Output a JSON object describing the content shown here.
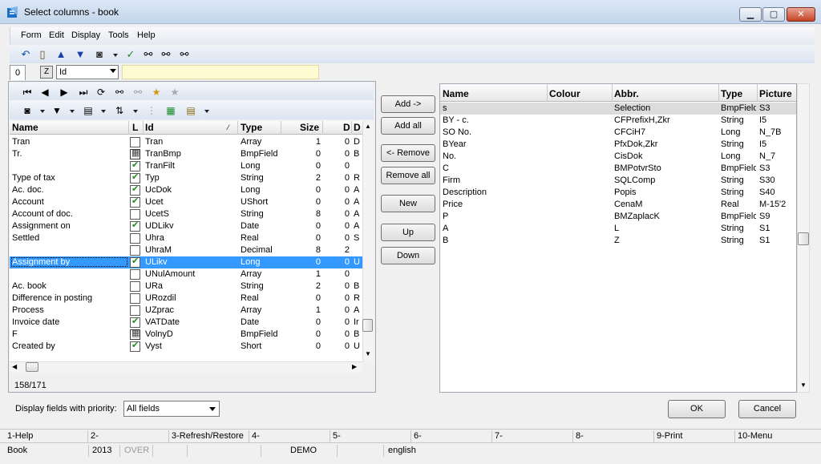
{
  "window": {
    "title": "Select columns - book"
  },
  "menu": [
    "Form",
    "Edit",
    "Display",
    "Tools",
    "Help"
  ],
  "tab": {
    "label": "0"
  },
  "z_button": "Z",
  "id_combo": {
    "value": "Id"
  },
  "left_grid": {
    "headers": [
      "Name",
      "L",
      "Id",
      "Type",
      "Size",
      "D",
      "D"
    ],
    "rows": [
      {
        "name": "Tran",
        "check": "off",
        "id": "Tran",
        "type": "Array",
        "size": "1",
        "d1": "0",
        "d2": "D"
      },
      {
        "name": "Tr.",
        "check": "img",
        "id": "TranBmp",
        "type": "BmpField",
        "size": "0",
        "d1": "0",
        "d2": "B"
      },
      {
        "name": "",
        "check": "on",
        "id": "TranFilt",
        "type": "Long",
        "size": "0",
        "d1": "0",
        "d2": ""
      },
      {
        "name": "Type of tax",
        "check": "on",
        "id": "Typ",
        "type": "String",
        "size": "2",
        "d1": "0",
        "d2": "R"
      },
      {
        "name": "Ac. doc.",
        "check": "on",
        "id": "UcDok",
        "type": "Long",
        "size": "0",
        "d1": "0",
        "d2": "A"
      },
      {
        "name": "Account",
        "check": "on",
        "id": "Ucet",
        "type": "UShort",
        "size": "0",
        "d1": "0",
        "d2": "A"
      },
      {
        "name": "Account of doc.",
        "check": "off",
        "id": "UcetS",
        "type": "String",
        "size": "8",
        "d1": "0",
        "d2": "A"
      },
      {
        "name": "Assignment on",
        "check": "on",
        "id": "UDLikv",
        "type": "Date",
        "size": "0",
        "d1": "0",
        "d2": "A"
      },
      {
        "name": "Settled",
        "check": "off",
        "id": "Uhra",
        "type": "Real",
        "size": "0",
        "d1": "0",
        "d2": "S"
      },
      {
        "name": "",
        "check": "off",
        "id": "UhraM",
        "type": "Decimal",
        "size": "8",
        "d1": "2",
        "d2": ""
      },
      {
        "name": "Assignment by",
        "check": "on",
        "id": "ULikv",
        "type": "Long",
        "size": "0",
        "d1": "0",
        "d2": "U"
      },
      {
        "name": "",
        "check": "off",
        "id": "UNulAmount",
        "type": "Array",
        "size": "1",
        "d1": "0",
        "d2": ""
      },
      {
        "name": "Ac. book",
        "check": "off",
        "id": "URa",
        "type": "String",
        "size": "2",
        "d1": "0",
        "d2": "B"
      },
      {
        "name": "Difference in posting",
        "check": "off",
        "id": "URozdil",
        "type": "Real",
        "size": "0",
        "d1": "0",
        "d2": "R"
      },
      {
        "name": "Process",
        "check": "off",
        "id": "UZprac",
        "type": "Array",
        "size": "1",
        "d1": "0",
        "d2": "A"
      },
      {
        "name": "Invoice date",
        "check": "on",
        "id": "VATDate",
        "type": "Date",
        "size": "0",
        "d1": "0",
        "d2": "Ir"
      },
      {
        "name": "F",
        "check": "img",
        "id": "VolnyD",
        "type": "BmpField",
        "size": "0",
        "d1": "0",
        "d2": "B"
      },
      {
        "name": "Created by",
        "check": "on",
        "id": "Vyst",
        "type": "Short",
        "size": "0",
        "d1": "0",
        "d2": "U"
      }
    ],
    "selected_index": 10
  },
  "count": "158/171",
  "middle_buttons": {
    "add": "Add ->",
    "add_all": "Add all",
    "remove": "<- Remove",
    "remove_all": "Remove all",
    "new": "New",
    "up": "Up",
    "down": "Down"
  },
  "right_grid": {
    "headers": [
      "Name",
      "Colour",
      "Abbr.",
      "Type",
      "Picture"
    ],
    "rows": [
      {
        "name": "s",
        "colour": "",
        "abbr": "Selection",
        "type": "BmpField",
        "picture": "S3"
      },
      {
        "name": "BY - c.",
        "colour": "",
        "abbr": "CFPrefixH,Zkr",
        "type": "String",
        "picture": "I5"
      },
      {
        "name": "SO No.",
        "colour": "",
        "abbr": "CFCiH7",
        "type": "Long",
        "picture": "N_7B"
      },
      {
        "name": "BYear",
        "colour": "",
        "abbr": "PfxDok,Zkr",
        "type": "String",
        "picture": "I5"
      },
      {
        "name": "No.",
        "colour": "",
        "abbr": "CisDok",
        "type": "Long",
        "picture": "N_7"
      },
      {
        "name": "C",
        "colour": "",
        "abbr": "BMPotvrSto",
        "type": "BmpField",
        "picture": "S3"
      },
      {
        "name": "Firm",
        "colour": "",
        "abbr": "SQLComp",
        "type": "String",
        "picture": "S30"
      },
      {
        "name": "Description",
        "colour": "",
        "abbr": "Popis",
        "type": "String",
        "picture": "S40"
      },
      {
        "name": "Price",
        "colour": "",
        "abbr": "CenaM",
        "type": "Real",
        "picture": "M-15'2"
      },
      {
        "name": "P",
        "colour": "",
        "abbr": "BMZaplacK",
        "type": "BmpField",
        "picture": "S9"
      },
      {
        "name": "A",
        "colour": "",
        "abbr": "L",
        "type": "String",
        "picture": "S1"
      },
      {
        "name": "B",
        "colour": "",
        "abbr": "Z",
        "type": "String",
        "picture": "S1"
      }
    ],
    "selected_index": 0
  },
  "priority": {
    "label": "Display fields with priority:",
    "value": "All fields"
  },
  "dialog_buttons": {
    "ok": "OK",
    "cancel": "Cancel"
  },
  "fkeys": [
    "1-Help",
    "2-",
    "3-Refresh/Restore",
    "4-",
    "5-",
    "6-",
    "7-",
    "8-",
    "9-Print",
    "10-Menu"
  ],
  "status": {
    "book": "Book",
    "year": "2013",
    "mode": "OVER",
    "db": "DEMO",
    "lang": "english"
  }
}
